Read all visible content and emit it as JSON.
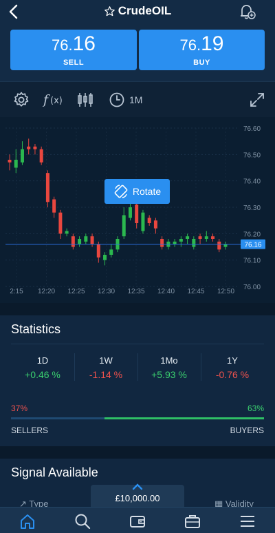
{
  "header": {
    "title": "CrudeOIL"
  },
  "trade": {
    "sell": {
      "price_small": "76.",
      "price_big": "16",
      "label": "SELL"
    },
    "buy": {
      "price_small": "76.",
      "price_big": "19",
      "label": "BUY"
    }
  },
  "toolbar": {
    "timeframe": "1M"
  },
  "chart_data": {
    "type": "candlestick",
    "y_ticks": [
      "76.60",
      "76.50",
      "76.40",
      "76.30",
      "76.20",
      "76.10",
      "76.00"
    ],
    "x_ticks": [
      "2:15",
      "12:20",
      "12:25",
      "12:30",
      "12:35",
      "12:40",
      "12:45",
      "12:50"
    ],
    "ylim": [
      76.0,
      76.6
    ],
    "current_price": "76.16",
    "current_price_value": 76.16,
    "candles": [
      {
        "o": 76.48,
        "c": 76.47,
        "h": 76.5,
        "l": 76.44
      },
      {
        "o": 76.45,
        "c": 76.48,
        "h": 76.52,
        "l": 76.43
      },
      {
        "o": 76.47,
        "c": 76.52,
        "h": 76.55,
        "l": 76.46
      },
      {
        "o": 76.53,
        "c": 76.52,
        "h": 76.56,
        "l": 76.5
      },
      {
        "o": 76.53,
        "c": 76.52,
        "h": 76.54,
        "l": 76.5
      },
      {
        "o": 76.52,
        "c": 76.47,
        "h": 76.53,
        "l": 76.46
      },
      {
        "o": 76.43,
        "c": 76.32,
        "h": 76.44,
        "l": 76.3
      },
      {
        "o": 76.33,
        "c": 76.28,
        "h": 76.34,
        "l": 76.26
      },
      {
        "o": 76.28,
        "c": 76.2,
        "h": 76.29,
        "l": 76.18
      },
      {
        "o": 76.2,
        "c": 76.21,
        "h": 76.22,
        "l": 76.19
      },
      {
        "o": 76.19,
        "c": 76.15,
        "h": 76.2,
        "l": 76.14
      },
      {
        "o": 76.16,
        "c": 76.18,
        "h": 76.19,
        "l": 76.15
      },
      {
        "o": 76.17,
        "c": 76.19,
        "h": 76.2,
        "l": 76.16
      },
      {
        "o": 76.19,
        "c": 76.16,
        "h": 76.2,
        "l": 76.15
      },
      {
        "o": 76.16,
        "c": 76.11,
        "h": 76.17,
        "l": 76.09
      },
      {
        "o": 76.1,
        "c": 76.12,
        "h": 76.13,
        "l": 76.08
      },
      {
        "o": 76.12,
        "c": 76.14,
        "h": 76.16,
        "l": 76.11
      },
      {
        "o": 76.14,
        "c": 76.18,
        "h": 76.19,
        "l": 76.13
      },
      {
        "o": 76.19,
        "c": 76.27,
        "h": 76.3,
        "l": 76.18
      },
      {
        "o": 76.26,
        "c": 76.3,
        "h": 76.32,
        "l": 76.25
      },
      {
        "o": 76.31,
        "c": 76.24,
        "h": 76.32,
        "l": 76.22
      },
      {
        "o": 76.21,
        "c": 76.28,
        "h": 76.29,
        "l": 76.2
      },
      {
        "o": 76.26,
        "c": 76.24,
        "h": 76.27,
        "l": 76.23
      },
      {
        "o": 76.25,
        "c": 76.22,
        "h": 76.26,
        "l": 76.2
      },
      {
        "o": 76.18,
        "c": 76.15,
        "h": 76.19,
        "l": 76.14
      },
      {
        "o": 76.15,
        "c": 76.17,
        "h": 76.18,
        "l": 76.14
      },
      {
        "o": 76.16,
        "c": 76.17,
        "h": 76.18,
        "l": 76.15
      },
      {
        "o": 76.17,
        "c": 76.18,
        "h": 76.19,
        "l": 76.15
      },
      {
        "o": 76.18,
        "c": 76.19,
        "h": 76.2,
        "l": 76.16
      },
      {
        "o": 76.15,
        "c": 76.18,
        "h": 76.19,
        "l": 76.14
      },
      {
        "o": 76.19,
        "c": 76.18,
        "h": 76.2,
        "l": 76.16
      },
      {
        "o": 76.18,
        "c": 76.19,
        "h": 76.21,
        "l": 76.17
      },
      {
        "o": 76.19,
        "c": 76.18,
        "h": 76.2,
        "l": 76.17
      },
      {
        "o": 76.17,
        "c": 76.14,
        "h": 76.18,
        "l": 76.13
      },
      {
        "o": 76.15,
        "c": 76.16,
        "h": 76.17,
        "l": 76.14
      }
    ],
    "up_color": "#2bb84f",
    "down_color": "#e9473f"
  },
  "rotate": {
    "label": "Rotate"
  },
  "statistics": {
    "title": "Statistics",
    "periods": [
      {
        "name": "1D",
        "value": "+0.46 %",
        "dir": "pos"
      },
      {
        "name": "1W",
        "value": "-1.14 %",
        "dir": "neg"
      },
      {
        "name": "1Mo",
        "value": "+5.93 %",
        "dir": "pos"
      },
      {
        "name": "1Y",
        "value": "-0.76 %",
        "dir": "neg"
      }
    ],
    "sellers_pct": "37%",
    "buyers_pct": "63%",
    "buyers_fraction": 0.63,
    "sellers_label": "SELLERS",
    "buyers_label": "BUYERS"
  },
  "signal": {
    "title": "Signal Available",
    "type_label": "Type",
    "validity_label": "Validity"
  },
  "balance": {
    "value": "£10,000.00"
  },
  "colors": {
    "accent": "#2a8ff0",
    "positive": "#3bd16f",
    "negative": "#f0524d",
    "price_line": "#2a6fe0"
  }
}
